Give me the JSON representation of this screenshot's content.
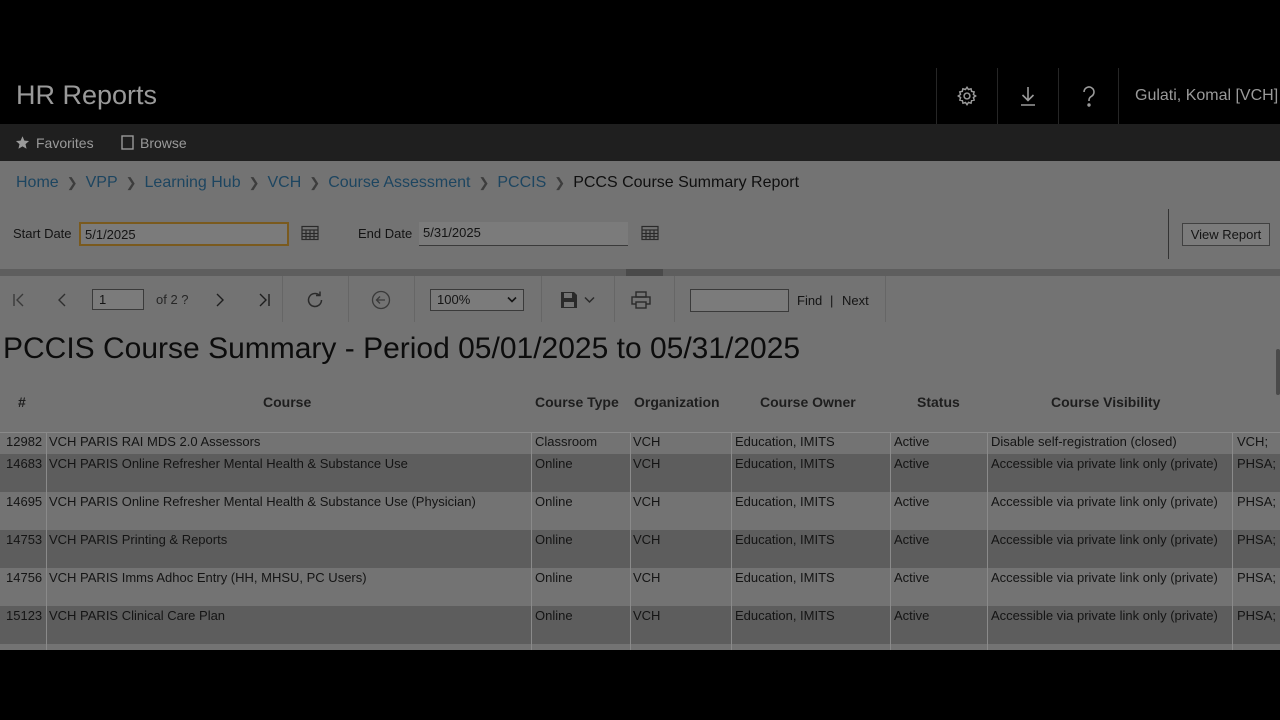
{
  "header": {
    "app_title": "HR Reports",
    "user_name": "Gulati, Komal [VCH]",
    "icons": [
      "gear-icon",
      "download-icon",
      "help-icon"
    ]
  },
  "nav": {
    "favorites": "Favorites",
    "browse": "Browse"
  },
  "breadcrumb": [
    "Home",
    "VPP",
    "Learning Hub",
    "VCH",
    "Course Assessment",
    "PCCIS",
    "PCCS Course Summary Report"
  ],
  "params": {
    "start_label": "Start Date",
    "start_value": "5/1/2025",
    "end_label": "End Date",
    "end_value": "5/31/2025",
    "view_report": "View Report"
  },
  "toolbar": {
    "page_value": "1",
    "page_of": "of 2 ?",
    "zoom": "100%",
    "find_label": "Find",
    "find_sep": "|",
    "next_label": "Next"
  },
  "report": {
    "title": "PCCIS Course Summary - Period 05/01/2025 to 05/31/2025",
    "columns": [
      "#",
      "Course",
      "Course Type",
      "Organization",
      "Course Owner",
      "Status",
      "Course Visibility"
    ],
    "rows": [
      [
        "12982",
        "VCH PARIS RAI MDS 2.0 Assessors",
        "Classroom",
        "VCH",
        "Education, IMITS",
        "Active",
        "Disable self-registration (closed)",
        "VCH;"
      ],
      [
        "14683",
        "VCH PARIS Online Refresher Mental Health & Substance Use",
        "Online",
        "VCH",
        "Education, IMITS",
        "Active",
        "Accessible via private link only (private)",
        "PHSA;"
      ],
      [
        "14695",
        "VCH PARIS Online Refresher Mental Health & Substance Use (Physician)",
        "Online",
        "VCH",
        "Education, IMITS",
        "Active",
        "Accessible via private link only (private)",
        "PHSA;"
      ],
      [
        "14753",
        "VCH PARIS Printing & Reports",
        "Online",
        "VCH",
        "Education, IMITS",
        "Active",
        "Accessible via private link only (private)",
        "PHSA;"
      ],
      [
        "14756",
        "VCH PARIS Imms Adhoc Entry (HH, MHSU, PC Users)",
        "Online",
        "VCH",
        "Education, IMITS",
        "Active",
        "Accessible via private link only (private)",
        "PHSA;"
      ],
      [
        "15123",
        "VCH PARIS Clinical Care Plan",
        "Online",
        "VCH",
        "Education, IMITS",
        "Active",
        "Accessible via private link only (private)",
        "PHSA;"
      ]
    ]
  },
  "colors": {
    "header_bg": "#000000",
    "nav_bg": "#1f1f1f",
    "page_bg": "#737373",
    "link": "#1d4560",
    "focus_border": "#7a5a1e"
  }
}
